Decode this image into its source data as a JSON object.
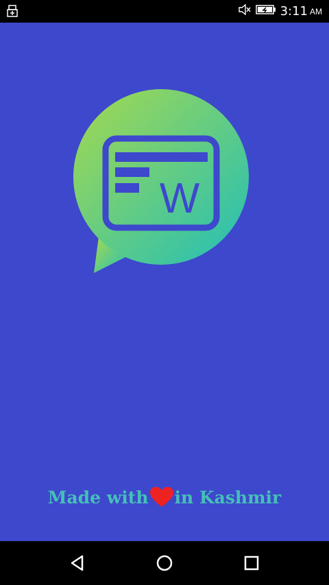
{
  "status_bar": {
    "time": "3:11",
    "ampm": "AM",
    "icons": [
      "usb-icon",
      "mute-icon",
      "battery-charging-icon"
    ]
  },
  "tagline": {
    "before": "Made with",
    "after": "in Kashmir",
    "heart_color": "#ee2222"
  },
  "logo": {
    "letter": "W",
    "gradient_start": "#a6d94e",
    "gradient_end": "#22bfb8"
  },
  "colors": {
    "background": "#3d48cc",
    "tagline": "#45c0b8"
  },
  "nav_bar": {
    "buttons": [
      "back-icon",
      "home-icon",
      "recents-icon"
    ]
  }
}
